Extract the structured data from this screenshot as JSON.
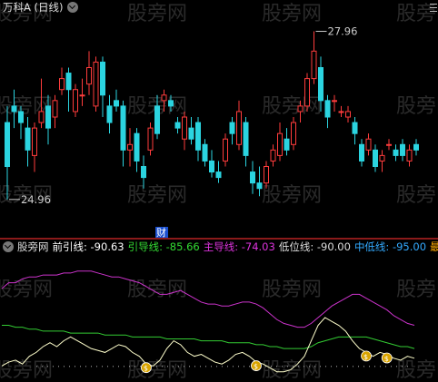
{
  "price_header": {
    "title": "万科A (日线)"
  },
  "price_annotations": {
    "high_label": "27.96",
    "low_label": "24.96",
    "cai_badge": "财"
  },
  "watermark": "股旁网",
  "indicator_header": {
    "name": "股旁网",
    "items": [
      {
        "label": "前引线:",
        "value": "-90.63",
        "color": "#ffffff"
      },
      {
        "label": "引导线:",
        "value": "-85.66",
        "color": "#33dd33"
      },
      {
        "label": "主导线:",
        "value": "-74.03",
        "color": "#dd33dd"
      },
      {
        "label": "低位线:",
        "value": "-90.00",
        "color": "#dddddd"
      },
      {
        "label": "中低线:",
        "value": "-95.00",
        "color": "#33aaff"
      },
      {
        "label": "最",
        "value": "",
        "color": "#ffaa00"
      }
    ]
  },
  "colors": {
    "up": "#ff3c3c",
    "down": "#2bd4e0",
    "main_line": "#cc33cc",
    "guide_line": "#33cc33",
    "lead_line": "#ffffcc",
    "dots": "#bbbbbb",
    "bag": "#d9a400"
  },
  "chart_data": {
    "type": "candlestick",
    "ylim": [
      24.6,
      28.2
    ],
    "candles": [
      {
        "o": 26.3,
        "h": 26.6,
        "l": 24.9,
        "c": 25.5
      },
      {
        "o": 26.6,
        "h": 26.9,
        "l": 26.2,
        "c": 26.5
      },
      {
        "o": 26.5,
        "h": 26.6,
        "l": 26.0,
        "c": 26.3
      },
      {
        "o": 26.2,
        "h": 26.4,
        "l": 25.5,
        "c": 25.8
      },
      {
        "o": 25.7,
        "h": 26.3,
        "l": 25.4,
        "c": 26.2
      },
      {
        "o": 26.3,
        "h": 27.1,
        "l": 26.2,
        "c": 26.5
      },
      {
        "o": 26.6,
        "h": 26.8,
        "l": 25.9,
        "c": 26.2
      },
      {
        "o": 26.4,
        "h": 26.8,
        "l": 26.2,
        "c": 26.7
      },
      {
        "o": 26.9,
        "h": 27.3,
        "l": 26.8,
        "c": 27.1
      },
      {
        "o": 27.2,
        "h": 27.3,
        "l": 26.5,
        "c": 26.9
      },
      {
        "o": 26.5,
        "h": 27.0,
        "l": 26.4,
        "c": 26.9
      },
      {
        "o": 26.8,
        "h": 27.1,
        "l": 26.6,
        "c": 26.8
      },
      {
        "o": 27.0,
        "h": 27.6,
        "l": 26.8,
        "c": 27.3
      },
      {
        "o": 26.6,
        "h": 27.5,
        "l": 26.5,
        "c": 27.4
      },
      {
        "o": 27.4,
        "h": 27.5,
        "l": 26.4,
        "c": 26.8
      },
      {
        "o": 26.6,
        "h": 26.8,
        "l": 26.1,
        "c": 26.3
      },
      {
        "o": 26.7,
        "h": 26.9,
        "l": 26.5,
        "c": 26.6
      },
      {
        "o": 26.6,
        "h": 26.7,
        "l": 25.5,
        "c": 25.8
      },
      {
        "o": 25.8,
        "h": 26.2,
        "l": 25.5,
        "c": 25.9
      },
      {
        "o": 26.1,
        "h": 26.2,
        "l": 25.4,
        "c": 25.6
      },
      {
        "o": 25.5,
        "h": 25.7,
        "l": 25.1,
        "c": 25.3
      },
      {
        "o": 25.8,
        "h": 26.3,
        "l": 25.7,
        "c": 26.2
      },
      {
        "o": 26.6,
        "h": 26.8,
        "l": 26.0,
        "c": 26.1
      },
      {
        "o": 26.7,
        "h": 26.9,
        "l": 26.5,
        "c": 26.8
      },
      {
        "o": 26.7,
        "h": 26.8,
        "l": 26.5,
        "c": 26.6
      },
      {
        "o": 26.3,
        "h": 26.4,
        "l": 26.1,
        "c": 26.2
      },
      {
        "o": 26.0,
        "h": 26.5,
        "l": 25.8,
        "c": 26.4
      },
      {
        "o": 26.2,
        "h": 26.4,
        "l": 25.9,
        "c": 26.0
      },
      {
        "o": 26.3,
        "h": 26.4,
        "l": 25.6,
        "c": 25.8
      },
      {
        "o": 25.9,
        "h": 26.0,
        "l": 25.5,
        "c": 25.6
      },
      {
        "o": 25.6,
        "h": 25.8,
        "l": 25.3,
        "c": 25.4
      },
      {
        "o": 25.4,
        "h": 25.6,
        "l": 25.2,
        "c": 25.3
      },
      {
        "o": 25.6,
        "h": 26.1,
        "l": 25.5,
        "c": 26.0
      },
      {
        "o": 26.3,
        "h": 26.4,
        "l": 25.9,
        "c": 26.1
      },
      {
        "o": 25.9,
        "h": 26.7,
        "l": 25.8,
        "c": 26.5
      },
      {
        "o": 26.3,
        "h": 26.4,
        "l": 25.5,
        "c": 25.7
      },
      {
        "o": 25.4,
        "h": 25.6,
        "l": 25.0,
        "c": 25.2
      },
      {
        "o": 25.2,
        "h": 25.5,
        "l": 24.96,
        "c": 25.1
      },
      {
        "o": 25.2,
        "h": 25.6,
        "l": 25.1,
        "c": 25.5
      },
      {
        "o": 25.6,
        "h": 25.9,
        "l": 25.5,
        "c": 25.8
      },
      {
        "o": 25.7,
        "h": 26.3,
        "l": 25.6,
        "c": 26.1
      },
      {
        "o": 26.0,
        "h": 26.2,
        "l": 25.7,
        "c": 25.8
      },
      {
        "o": 25.9,
        "h": 26.4,
        "l": 25.8,
        "c": 26.3
      },
      {
        "o": 26.5,
        "h": 26.7,
        "l": 26.3,
        "c": 26.6
      },
      {
        "o": 26.6,
        "h": 27.2,
        "l": 26.5,
        "c": 27.1
      },
      {
        "o": 27.1,
        "h": 27.96,
        "l": 27.0,
        "c": 27.6
      },
      {
        "o": 27.3,
        "h": 27.5,
        "l": 26.5,
        "c": 26.7
      },
      {
        "o": 26.7,
        "h": 26.8,
        "l": 26.2,
        "c": 26.4
      },
      {
        "o": 26.7,
        "h": 26.8,
        "l": 26.5,
        "c": 26.7
      },
      {
        "o": 26.5,
        "h": 26.6,
        "l": 26.4,
        "c": 26.5
      },
      {
        "o": 26.4,
        "h": 26.6,
        "l": 26.3,
        "c": 26.5
      },
      {
        "o": 26.3,
        "h": 26.4,
        "l": 25.9,
        "c": 26.1
      },
      {
        "o": 25.9,
        "h": 26.0,
        "l": 25.5,
        "c": 25.6
      },
      {
        "o": 25.8,
        "h": 26.1,
        "l": 25.7,
        "c": 26.0
      },
      {
        "o": 25.8,
        "h": 25.9,
        "l": 25.4,
        "c": 25.5
      },
      {
        "o": 25.6,
        "h": 25.8,
        "l": 25.4,
        "c": 25.7
      },
      {
        "o": 25.9,
        "h": 26.0,
        "l": 25.8,
        "c": 25.9
      },
      {
        "o": 25.8,
        "h": 25.9,
        "l": 25.6,
        "c": 25.7
      },
      {
        "o": 25.9,
        "h": 26.0,
        "l": 25.6,
        "c": 25.7
      },
      {
        "o": 25.6,
        "h": 25.9,
        "l": 25.5,
        "c": 25.8
      },
      {
        "o": 25.9,
        "h": 26.0,
        "l": 25.7,
        "c": 25.8
      }
    ],
    "indicator": {
      "ylim": [
        -100,
        -40
      ],
      "main": [
        -55,
        -52,
        -52,
        -50,
        -49,
        -49,
        -48,
        -48,
        -48,
        -47,
        -47,
        -46,
        -46,
        -46,
        -47,
        -48,
        -49,
        -49,
        -50,
        -51,
        -52,
        -54,
        -56,
        -58,
        -58,
        -57,
        -56,
        -58,
        -60,
        -62,
        -63,
        -63,
        -64,
        -64,
        -63,
        -62,
        -62,
        -63,
        -65,
        -68,
        -71,
        -73,
        -74,
        -75,
        -75,
        -73,
        -70,
        -67,
        -64,
        -62,
        -60,
        -58,
        -58,
        -60,
        -62,
        -64,
        -66,
        -69,
        -71,
        -73,
        -74
      ],
      "guide": [
        -74,
        -74,
        -75,
        -75,
        -76,
        -76,
        -77,
        -77,
        -77,
        -77,
        -78,
        -78,
        -78,
        -78,
        -78,
        -79,
        -79,
        -79,
        -79,
        -80,
        -80,
        -80,
        -80,
        -80,
        -81,
        -81,
        -81,
        -81,
        -81,
        -82,
        -82,
        -82,
        -82,
        -83,
        -83,
        -83,
        -83,
        -84,
        -84,
        -85,
        -85,
        -86,
        -86,
        -86,
        -86,
        -85,
        -83,
        -82,
        -81,
        -80,
        -80,
        -80,
        -80,
        -80,
        -81,
        -82,
        -83,
        -84,
        -85,
        -85,
        -86
      ],
      "lead": [
        -95,
        -93,
        -92,
        -94,
        -90,
        -88,
        -85,
        -83,
        -85,
        -82,
        -80,
        -82,
        -84,
        -86,
        -87,
        -88,
        -86,
        -84,
        -85,
        -88,
        -90,
        -94,
        -95,
        -92,
        -86,
        -82,
        -84,
        -88,
        -90,
        -89,
        -91,
        -93,
        -94,
        -92,
        -89,
        -88,
        -90,
        -93,
        -94,
        -96,
        -98,
        -98,
        -97,
        -94,
        -90,
        -82,
        -74,
        -70,
        -72,
        -74,
        -77,
        -82,
        -86,
        -88,
        -90,
        -88,
        -89,
        -91,
        -92,
        -90,
        -91
      ],
      "dots_level": -95,
      "bag_indices": [
        21,
        37,
        53,
        56
      ]
    }
  }
}
